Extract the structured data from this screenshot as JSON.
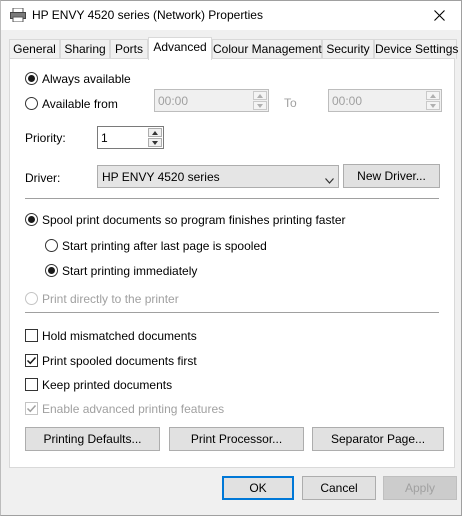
{
  "window": {
    "title": "HP ENVY 4520 series (Network) Properties",
    "icons": {
      "app": "printer-icon",
      "close": "close-icon"
    }
  },
  "tabs": [
    {
      "label": "General"
    },
    {
      "label": "Sharing"
    },
    {
      "label": "Ports"
    },
    {
      "label": "Advanced",
      "active": true
    },
    {
      "label": "Colour Management"
    },
    {
      "label": "Security"
    },
    {
      "label": "Device Settings"
    }
  ],
  "availability": {
    "always_label": "Always available",
    "from_label": "Available from",
    "from_time": "00:00",
    "to_label": "To",
    "to_time": "00:00",
    "selected": "always"
  },
  "priority": {
    "label": "Priority:",
    "value": "1"
  },
  "driver": {
    "label": "Driver:",
    "value": "HP ENVY 4520 series",
    "new_driver_label": "New Driver..."
  },
  "spooling": {
    "spool_label": "Spool print documents so program finishes printing faster",
    "after_last_page_label": "Start printing after last page is spooled",
    "immediately_label": "Start printing immediately",
    "direct_label": "Print directly to the printer",
    "selected_mode": "spool",
    "selected_start": "immediately"
  },
  "options": {
    "hold_mismatched": {
      "label": "Hold mismatched documents",
      "checked": false
    },
    "print_spooled_first": {
      "label": "Print spooled documents first",
      "checked": true
    },
    "keep_printed": {
      "label": "Keep printed documents",
      "checked": false
    },
    "enable_advanced": {
      "label": "Enable advanced printing features",
      "checked": true,
      "disabled": true
    }
  },
  "panel_buttons": {
    "printing_defaults": "Printing Defaults...",
    "print_processor": "Print Processor...",
    "separator_page": "Separator Page..."
  },
  "dialog_buttons": {
    "ok": "OK",
    "cancel": "Cancel",
    "apply": "Apply"
  },
  "colors": {
    "accent": "#0078d7",
    "window_bg": "#f0f0f0",
    "panel_bg": "#ffffff",
    "disabled_text": "#a0a0a0"
  }
}
